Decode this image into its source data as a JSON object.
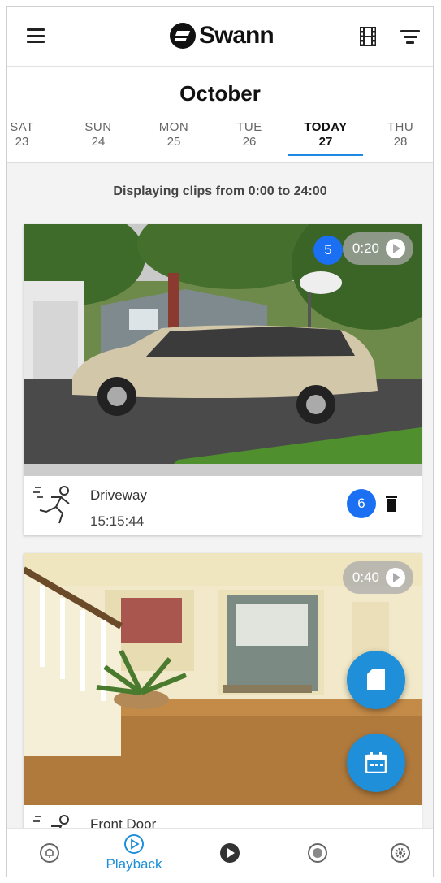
{
  "header": {
    "logo_text": "Swann",
    "menu_icon": "hamburger-menu-icon",
    "clips_icon": "film-strip-icon",
    "filter_icon": "filter-icon"
  },
  "calendar": {
    "month": "October",
    "days": [
      {
        "name": "SAT",
        "num": "23"
      },
      {
        "name": "SUN",
        "num": "24"
      },
      {
        "name": "MON",
        "num": "25"
      },
      {
        "name": "TUE",
        "num": "26"
      },
      {
        "name": "TODAY",
        "num": "27"
      },
      {
        "name": "THU",
        "num": "28"
      }
    ],
    "selected_index": 4
  },
  "caption": "Displaying clips from 0:00 to 24:00",
  "clips": [
    {
      "camera": "Driveway",
      "time": "15:15:44",
      "duration": "0:20",
      "badge_duration": "5",
      "badge_delete": "6"
    },
    {
      "camera": "Front Door",
      "duration": "0:40"
    }
  ],
  "nav": {
    "items": [
      {
        "icon": "alert-bell-icon",
        "label": ""
      },
      {
        "icon": "playback-icon",
        "label": "Playback"
      },
      {
        "icon": "live-play-icon",
        "label": ""
      },
      {
        "icon": "globe-icon",
        "label": ""
      },
      {
        "icon": "settings-gear-icon",
        "label": ""
      }
    ]
  },
  "colors": {
    "accent": "#1e8fd8",
    "badge": "#1b6ff2",
    "underline": "#1e88e5"
  }
}
